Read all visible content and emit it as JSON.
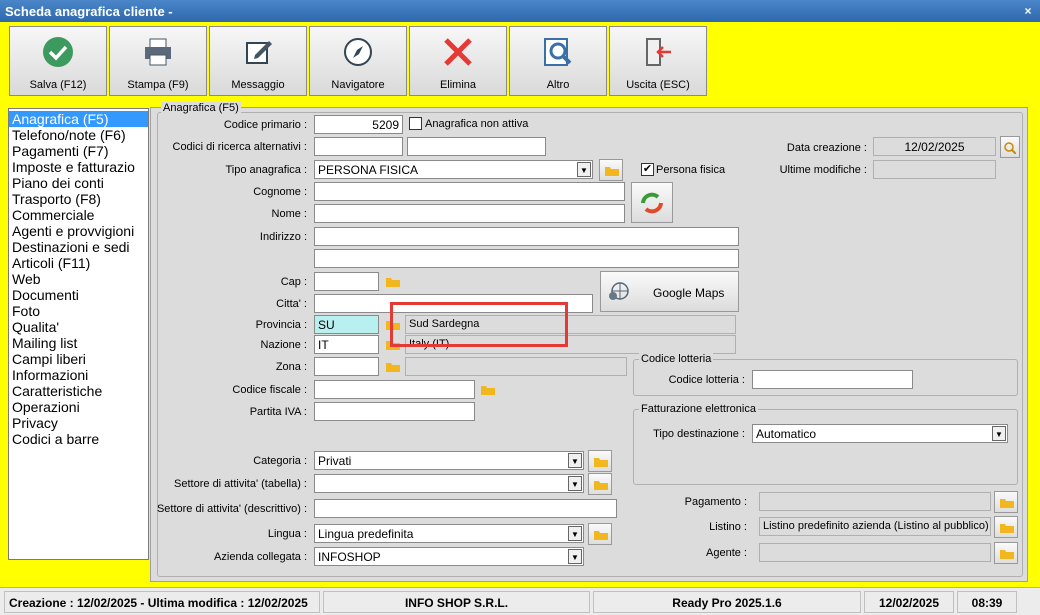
{
  "window": {
    "title": "Scheda anagrafica cliente -",
    "close": "×"
  },
  "toolbar": {
    "items": [
      "Salva (F12)",
      "Stampa (F9)",
      "Messaggio",
      "Navigatore",
      "Elimina",
      "Altro",
      "Uscita (ESC)"
    ]
  },
  "nav": {
    "items": [
      "Anagrafica (F5)",
      "Telefono/note (F6)",
      "Pagamenti (F7)",
      "Imposte e fatturazio",
      "Piano dei conti",
      "Trasporto (F8)",
      "Commerciale",
      "Agenti e provvigioni",
      "Destinazioni e sedi",
      "Articoli (F11)",
      "Web",
      "Documenti",
      "Foto",
      "Qualita'",
      "Mailing list",
      "Campi liberi",
      "Informazioni",
      "Caratteristiche",
      "Operazioni",
      "Privacy",
      "Codici a barre"
    ],
    "selected": 0
  },
  "form": {
    "legend": "Anagrafica (F5)",
    "codice_primario_label": "Codice primario :",
    "codice_primario": "5209",
    "non_attiva_label": "Anagrafica non attiva",
    "codici_alt_label": "Codici di ricerca alternativi :",
    "tipo_label": "Tipo anagrafica :",
    "tipo": "PERSONA FISICA",
    "persona_fisica_label": "Persona fisica",
    "cognome_label": "Cognome :",
    "nome_label": "Nome :",
    "indirizzo_label": "Indirizzo :",
    "cap_label": "Cap :",
    "citta_label": "Citta' :",
    "provincia_label": "Provincia :",
    "provincia": "SU",
    "provincia_desc": "Sud Sardegna",
    "nazione_label": "Nazione :",
    "nazione": "IT",
    "nazione_desc": "Italy (IT)",
    "zona_label": "Zona :",
    "cf_label": "Codice fiscale :",
    "piva_label": "Partita IVA :",
    "categoria_label": "Categoria :",
    "categoria": "Privati",
    "settore_tab_label": "Settore di attivita' (tabella) :",
    "settore_desc_label": "Settore di attivita' (descrittivo) :",
    "lingua_label": "Lingua :",
    "lingua": "Lingua predefinita",
    "azienda_label": "Azienda collegata :",
    "azienda": "INFOSHOP",
    "google_maps": "Google Maps",
    "data_creazione_label": "Data creazione :",
    "data_creazione": "12/02/2025",
    "ultime_mod_label": "Ultime modifiche :",
    "lotteria_legend": "Codice lotteria",
    "lotteria_label": "Codice lotteria :",
    "fe_legend": "Fatturazione elettronica",
    "tipo_dest_label": "Tipo destinazione :",
    "tipo_dest": "Automatico",
    "pagamento_label": "Pagamento :",
    "listino_label": "Listino :",
    "listino": "Listino predefinito azienda (Listino al pubblico)",
    "agente_label": "Agente :"
  },
  "status": {
    "creazione": "Creazione : 12/02/2025 - Ultima modifica : 12/02/2025",
    "company": "INFO SHOP S.R.L.",
    "version": "Ready Pro 2025.1.6",
    "date": "12/02/2025",
    "time": "08:39"
  },
  "colors": {
    "accent": "#ffff00",
    "highlight": "#e53935",
    "selected": "#3399ff"
  }
}
